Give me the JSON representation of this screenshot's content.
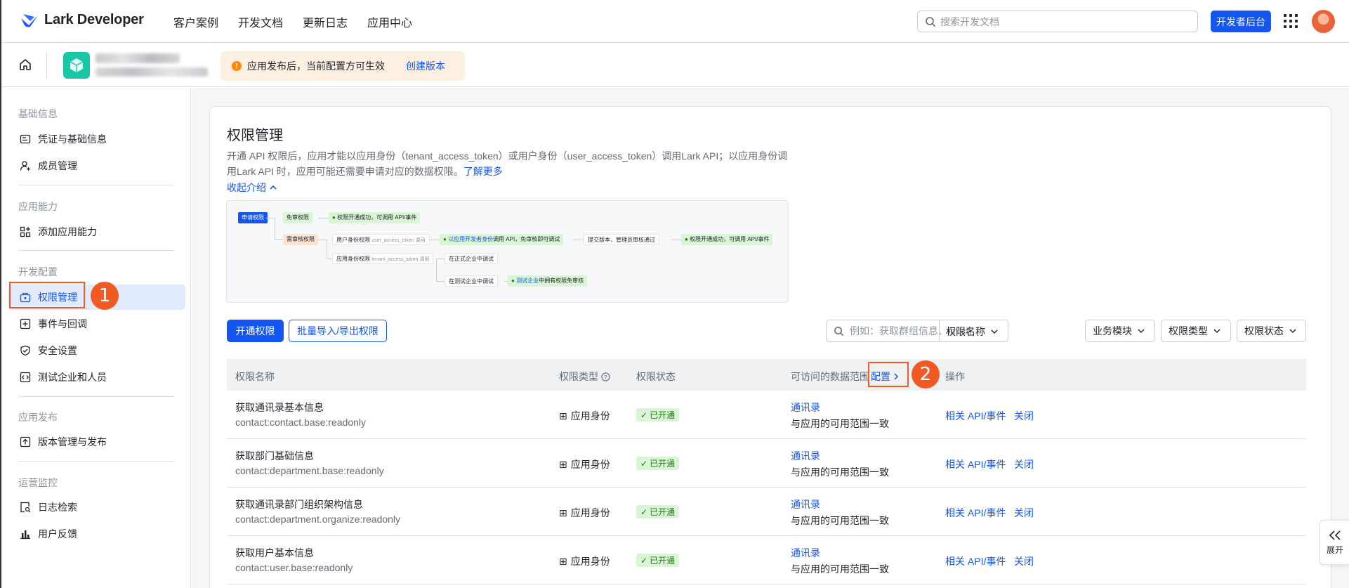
{
  "header": {
    "logo_text": "Lark Developer",
    "nav": [
      "客户案例",
      "开发文档",
      "更新日志",
      "应用中心"
    ],
    "search_placeholder": "搜索开发文档",
    "dev_console_label": "开发者后台"
  },
  "subheader": {
    "notice_text": "应用发布后，当前配置方可生效",
    "notice_link": "创建版本"
  },
  "sidebar": {
    "sections": [
      {
        "title": "基础信息",
        "items": [
          "凭证与基础信息",
          "成员管理"
        ]
      },
      {
        "title": "应用能力",
        "items": [
          "添加应用能力"
        ]
      },
      {
        "title": "开发配置",
        "items": [
          "权限管理",
          "事件与回调",
          "安全设置",
          "测试企业和人员"
        ]
      },
      {
        "title": "应用发布",
        "items": [
          "版本管理与发布"
        ]
      },
      {
        "title": "运营监控",
        "items": [
          "日志检索",
          "用户反馈"
        ]
      }
    ],
    "active_item": "权限管理"
  },
  "callouts": [
    "1",
    "2"
  ],
  "main": {
    "title": "权限管理",
    "description": "开通 API 权限后，应用才能以应用身份（tenant_access_token）或用户身份（user_access_token）调用Lark API；以应用身份调用Lark API 时，应用可能还需要申请对应的数据权限。",
    "learn_more": "了解更多",
    "collapse_label": "收起介绍",
    "flow": {
      "start": "申请权限",
      "no_review": "免审权限",
      "no_review_result": "权限开通成功，可调用 API/事件",
      "need_review": "需审核权限",
      "user_perm": "用户身份权限",
      "user_perm_sub": "user_access_token 调用",
      "user_result_hl": "以应用开发者身份",
      "user_result": "调用 API，免审核即可调试",
      "submit": "提交版本，管理员审核通过",
      "final_result": "权限开通成功，可调用 API/事件",
      "app_perm": "应用身份权限",
      "app_perm_sub": "tenant_access_token 调用",
      "formal": "在正式企业中调试",
      "test": "在测试企业中调试",
      "test_result_hl": "测试企业",
      "test_result": "中拥有权限免审核"
    },
    "toolbar": {
      "enable_btn": "开通权限",
      "batch_btn": "批量导入/导出权限",
      "search_placeholder": "例如：获取群组信息、im:ch...",
      "search_type": "权限名称",
      "filters": [
        "业务模块",
        "权限类型",
        "权限状态"
      ]
    },
    "table": {
      "headers": [
        "权限名称",
        "权限类型",
        "权限状态",
        "可访问的数据范围",
        "配置",
        "操作"
      ],
      "rows": [
        {
          "name": "获取通讯录基本信息",
          "scope": "contact:contact.base:readonly",
          "type": "应用身份",
          "status": "已开通",
          "range_link": "通讯录",
          "range_text": "与应用的可用范围一致",
          "action1": "相关 API/事件",
          "action2": "关闭"
        },
        {
          "name": "获取部门基础信息",
          "scope": "contact:department.base:readonly",
          "type": "应用身份",
          "status": "已开通",
          "range_link": "通讯录",
          "range_text": "与应用的可用范围一致",
          "action1": "相关 API/事件",
          "action2": "关闭"
        },
        {
          "name": "获取通讯录部门组织架构信息",
          "scope": "contact:department.organize:readonly",
          "type": "应用身份",
          "status": "已开通",
          "range_link": "通讯录",
          "range_text": "与应用的可用范围一致",
          "action1": "相关 API/事件",
          "action2": "关闭"
        },
        {
          "name": "获取用户基本信息",
          "scope": "contact:user.base:readonly",
          "type": "应用身份",
          "status": "已开通",
          "range_link": "通讯录",
          "range_text": "与应用的可用范围一致",
          "action1": "相关 API/事件",
          "action2": "关闭"
        }
      ]
    },
    "expand_label": "展开"
  },
  "colors": {
    "primary": "#1456f0",
    "callout": "#f15a22",
    "success_bg": "#d9f5d6",
    "success_text": "#237b19"
  }
}
